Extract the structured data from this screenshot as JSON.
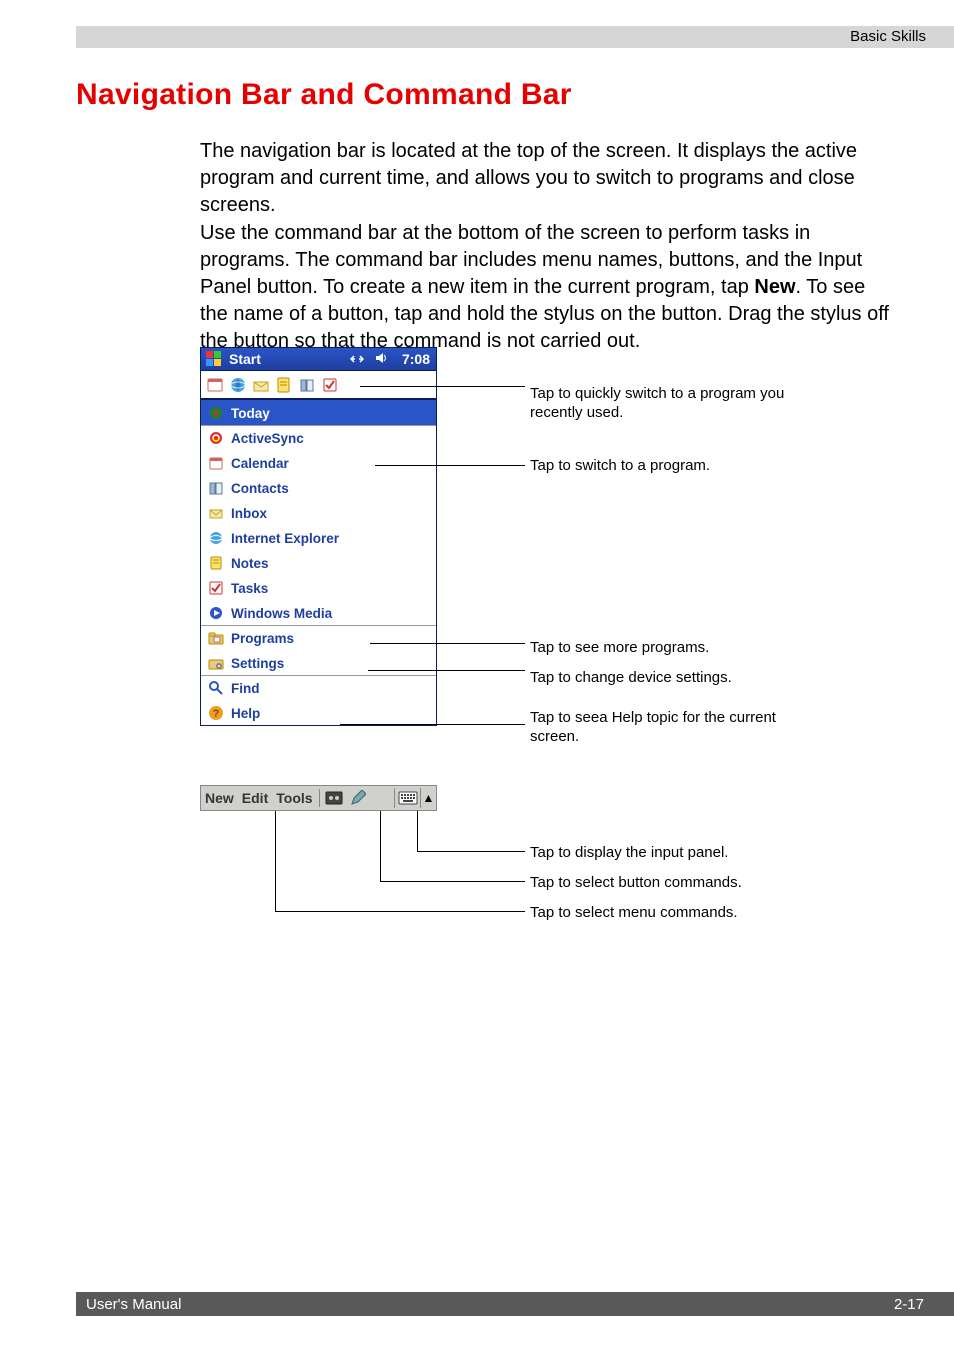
{
  "header": {
    "section": "Basic Skills"
  },
  "title": "Navigation Bar and Command Bar",
  "para1": "The navigation bar is located at the top of the screen. It displays the active program and current time, and allows you to switch to programs and close screens.",
  "para2_pre": "Use the command bar at the bottom of the screen to perform tasks in programs. The command bar includes menu names, buttons, and the Input Panel button. To create a new item in the current program, tap ",
  "para2_bold": "New",
  "para2_post": ". To see the name of a button, tap and hold the stylus on the button. Drag the stylus off the button so that the command is not carried out.",
  "startbar": {
    "label": "Start",
    "time": "7:08"
  },
  "menu": {
    "today": "Today",
    "items": [
      {
        "label": "ActiveSync"
      },
      {
        "label": "Calendar"
      },
      {
        "label": "Contacts"
      },
      {
        "label": "Inbox"
      },
      {
        "label": "Internet Explorer"
      },
      {
        "label": "Notes"
      },
      {
        "label": "Tasks"
      },
      {
        "label": "Windows Media"
      }
    ],
    "programs": "Programs",
    "settings": "Settings",
    "find": "Find",
    "help": "Help"
  },
  "callouts": {
    "recent": "Tap to quickly switch to a program you recently used.",
    "switch": "Tap to switch to a program.",
    "more": "Tap to see more programs.",
    "settings": "Tap to change device settings.",
    "help": "Tap to seea Help topic for the current screen."
  },
  "cmdbar": {
    "new": "New",
    "edit": "Edit",
    "tools": "Tools"
  },
  "cmd_callouts": {
    "input": "Tap to display the input panel.",
    "buttons": "Tap to select button commands.",
    "menus": "Tap to select menu commands."
  },
  "footer": {
    "left": "User's Manual",
    "right": "2-17"
  }
}
